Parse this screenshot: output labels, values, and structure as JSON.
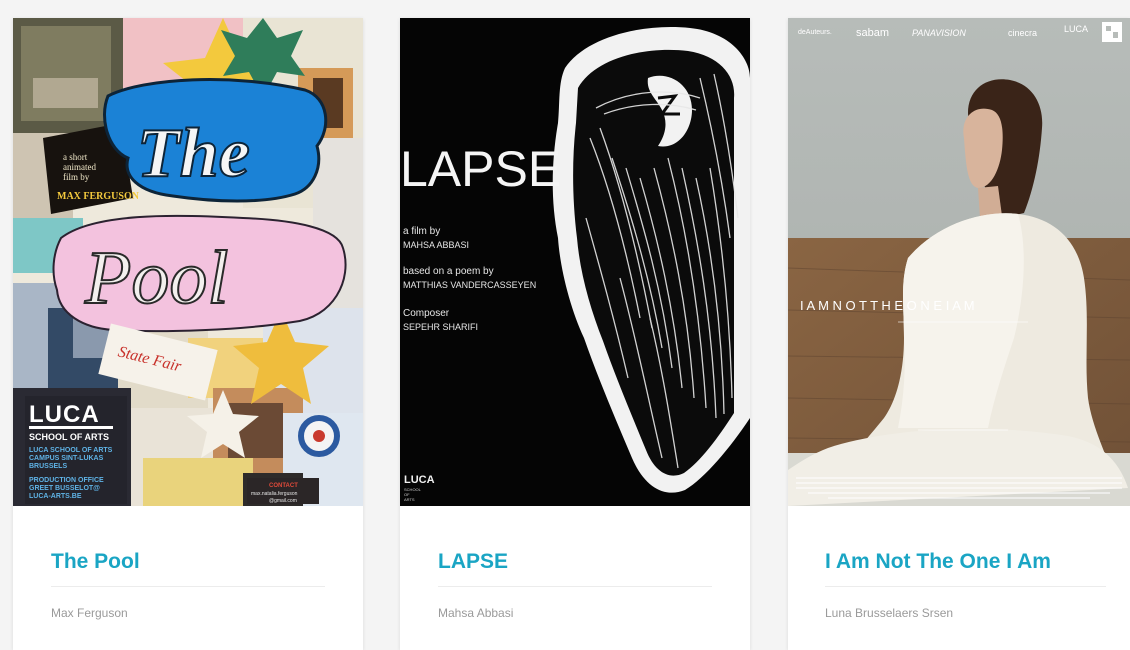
{
  "films": [
    {
      "title": "The Pool",
      "author": "Max Ferguson",
      "poster": {
        "headline_1": "The",
        "headline_2": "Pool",
        "tagline_1": "a short",
        "tagline_2": "animated",
        "tagline_3": "film by",
        "director": "MAX FERGUSON",
        "stamp": "State Fair",
        "school": "LUCA",
        "school_sub": "SCHOOL OF ARTS",
        "credit_1": "LUCA SCHOOL OF ARTS",
        "credit_2": "CAMPUS SINT-LUKAS",
        "credit_3": "BRUSSELS",
        "credit_4": "PRODUCTION OFFICE",
        "credit_5": "GREET BUSSELOT@",
        "credit_6": "LUCA-ARTS.BE",
        "contact_1": "CONTACT",
        "contact_2": "max.natalia.ferguson",
        "contact_3": "@gmail.com"
      }
    },
    {
      "title": "LAPSE",
      "author": "Mahsa Abbasi",
      "poster": {
        "headline": "LAPSE",
        "line_1": "a film by",
        "line_2": "MAHSA ABBASI",
        "line_3": "based on a poem by",
        "line_4": "MATTHIAS VANDERCASSEYEN",
        "line_5": "Composer",
        "line_6": "SEPEHR SHARIFI",
        "logo": "LUCA",
        "logo_sub_1": "SCHOOL",
        "logo_sub_2": "OF",
        "logo_sub_3": "ARTS"
      }
    },
    {
      "title": "I Am Not The One I Am",
      "author": "Luna Brusselaers Srsen",
      "poster": {
        "headline": "I A M N O T T H E O N E I A M",
        "sponsor_1": "deAuteurs.",
        "sponsor_2": "sabam",
        "sponsor_3": "PANAVISION",
        "sponsor_4": "cinecra",
        "sponsor_5": "LUCA"
      }
    }
  ]
}
